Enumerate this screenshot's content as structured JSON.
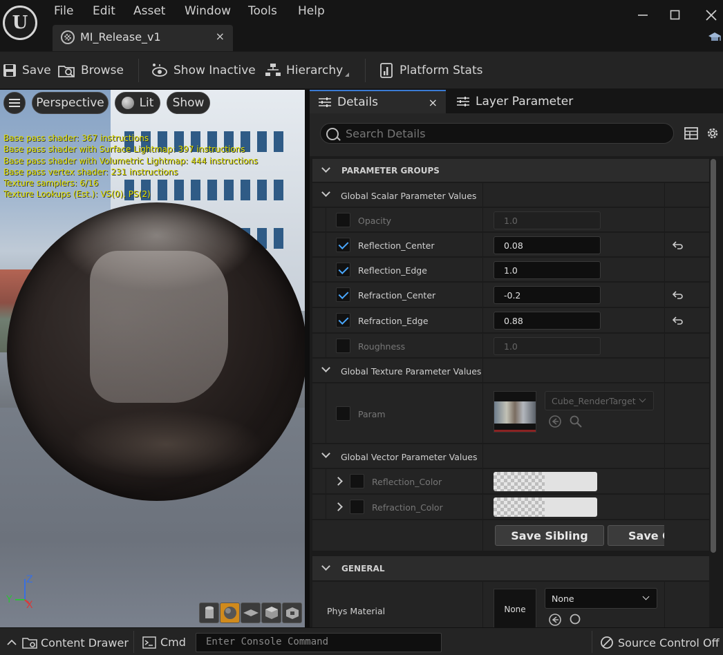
{
  "app": {
    "logo_letter": "U",
    "menu": [
      "File",
      "Edit",
      "Asset",
      "Window",
      "Tools",
      "Help"
    ],
    "document_tab": "MI_Release_v1",
    "close_glyph": "×"
  },
  "toolbar": {
    "save": "Save",
    "browse": "Browse",
    "show_inactive": "Show Inactive",
    "hierarchy": "Hierarchy",
    "platform_stats": "Platform Stats"
  },
  "viewport": {
    "perspective": "Perspective",
    "lit": "Lit",
    "show": "Show",
    "stats": [
      "Base pass shader: 367 instructions",
      "Base pass shader with Surface Lightmap: 397 instructions",
      "Base pass shader with Volumetric Lightmap: 444 instructions",
      "Base pass vertex shader: 231 instructions",
      "Texture samplers: 6/16",
      "Texture Lookups (Est.): VS(0), PS(2)"
    ],
    "gizmo": {
      "z": "Z",
      "y": "Y",
      "x": "X"
    },
    "colors": {
      "stats_text": "#e2e200",
      "lit_active": "#d08a1c"
    }
  },
  "details": {
    "tab_details": "Details",
    "tab_layer": "Layer Parameter",
    "search_placeholder": "Search Details",
    "parameter_groups": "PARAMETER GROUPS",
    "scalar_group": "Global Scalar Parameter Values",
    "scalars": [
      {
        "name": "Opacity",
        "value": "1.0",
        "enabled": false,
        "reset": false
      },
      {
        "name": "Reflection_Center",
        "value": "0.08",
        "enabled": true,
        "reset": true
      },
      {
        "name": "Reflection_Edge",
        "value": "1.0",
        "enabled": true,
        "reset": false
      },
      {
        "name": "Refraction_Center",
        "value": "-0.2",
        "enabled": true,
        "reset": true
      },
      {
        "name": "Refraction_Edge",
        "value": "0.88",
        "enabled": true,
        "reset": true
      },
      {
        "name": "Roughness",
        "value": "1.0",
        "enabled": false,
        "reset": false
      }
    ],
    "texture_group": "Global Texture Parameter Values",
    "texture_param": {
      "name": "Param",
      "dropdown": "Cube_RenderTarget"
    },
    "vector_group": "Global Vector Parameter Values",
    "vectors": [
      {
        "name": "Reflection_Color"
      },
      {
        "name": "Refraction_Color"
      }
    ],
    "save_sibling": "Save Sibling",
    "save_child": "Save C",
    "general": "GENERAL",
    "phys_material": {
      "label": "Phys Material",
      "thumb": "None",
      "dropdown": "None"
    },
    "colors": {
      "accent": "#3a7bd5",
      "check": "#4aa8ff"
    }
  },
  "statusbar": {
    "content_drawer": "Content Drawer",
    "cmd": "Cmd",
    "console_placeholder": "Enter Console Command",
    "source_control": "Source Control Off"
  }
}
